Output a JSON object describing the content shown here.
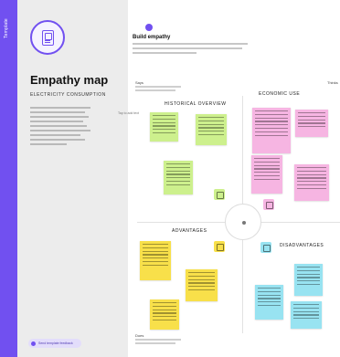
{
  "sidebar_tab": {
    "label": "Template"
  },
  "left_panel": {
    "title": "Empathy map",
    "subtitle": "ELECTRICITY CONSUMPTION",
    "feedback_label": "Send template feedback"
  },
  "step": {
    "title": "Build empathy",
    "description": "The information you have should be representative of the observations and research you've done about your users."
  },
  "side_note": "Tap to add text",
  "corners": {
    "top_left_title": "Says",
    "top_right_title": "Thinks",
    "bottom_left_title": "Does"
  },
  "quadrants": {
    "top_left": "HISTORICAL OVERVIEW",
    "top_right": "ECONOMIC USE",
    "bottom_left": "ADVANTAGES",
    "bottom_right": "DISADVANTAGES"
  },
  "colors": {
    "accent": "#7150f0",
    "sticky_green": "#cdf08d",
    "sticky_pink": "#f6b5e2",
    "sticky_yellow": "#f8e04a",
    "sticky_cyan": "#98e3f1"
  },
  "icons": {
    "quadrant_top_left": "thumbs-icon",
    "quadrant_top_right": "speech-icon",
    "quadrant_bottom_left": "hand-icon",
    "quadrant_bottom_right": "heart-icon"
  }
}
